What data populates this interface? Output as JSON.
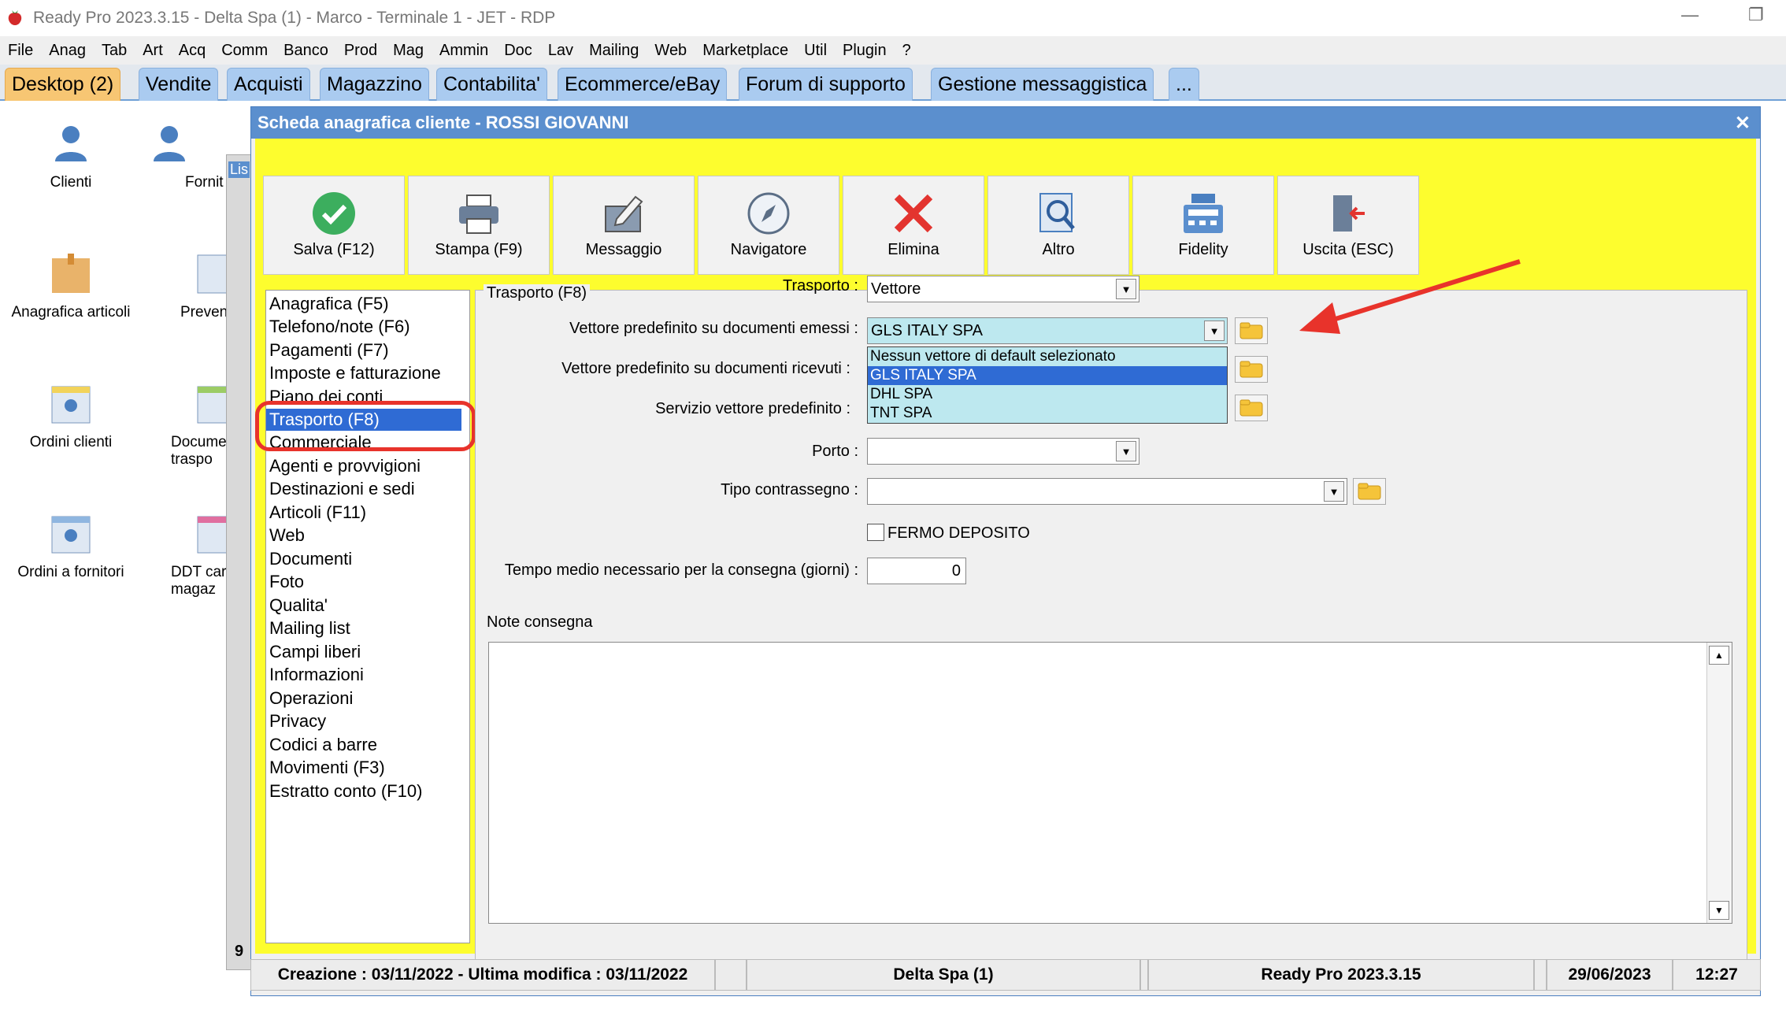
{
  "app": {
    "window_title": "Ready Pro 2023.3.15 - Delta Spa (1) - Marco - Terminale 1 - JET - RDP"
  },
  "menu": [
    "File",
    "Anag",
    "Tab",
    "Art",
    "Acq",
    "Comm",
    "Banco",
    "Prod",
    "Mag",
    "Ammin",
    "Doc",
    "Lav",
    "Mailing",
    "Web",
    "Marketplace",
    "Util",
    "Plugin",
    "?"
  ],
  "tabs": [
    "Desktop (2)",
    "Vendite",
    "Acquisti",
    "Magazzino",
    "Contabilita'",
    "Ecommerce/eBay",
    "Forum di supporto",
    "Gestione messaggistica",
    "..."
  ],
  "desktop_icons": [
    {
      "label": "Clienti"
    },
    {
      "label": "Fornit"
    },
    {
      "label": "Anagrafica articoli"
    },
    {
      "label": "Preven"
    },
    {
      "label": "Ordini clienti"
    },
    {
      "label": "Docume\ntraspo"
    },
    {
      "label": "Ordini a fornitori"
    },
    {
      "label": "DDT car\nmagaz"
    }
  ],
  "bg_window": {
    "tab_label": "Lis",
    "footer": "9"
  },
  "dialog": {
    "title": "Scheda anagrafica cliente - ROSSI GIOVANNI",
    "toolbar": [
      {
        "label": "Salva (F12)",
        "icon": "check-icon"
      },
      {
        "label": "Stampa (F9)",
        "icon": "printer-icon"
      },
      {
        "label": "Messaggio",
        "icon": "message-icon"
      },
      {
        "label": "Navigatore",
        "icon": "compass-icon"
      },
      {
        "label": "Elimina",
        "icon": "delete-icon"
      },
      {
        "label": "Altro",
        "icon": "search-icon"
      },
      {
        "label": "Fidelity",
        "icon": "register-icon"
      },
      {
        "label": "Uscita (ESC)",
        "icon": "exit-icon"
      }
    ],
    "nav": [
      "Anagrafica (F5)",
      "Telefono/note (F6)",
      "Pagamenti (F7)",
      "Imposte e fatturazione",
      "Piano dei conti",
      "Trasporto (F8)",
      "Commerciale",
      "Agenti e provvigioni",
      "Destinazioni e sedi",
      "Articoli (F11)",
      "Web",
      "Documenti",
      "Foto",
      "Qualita'",
      "Mailing list",
      "Campi liberi",
      "Informazioni",
      "Operazioni",
      "Privacy",
      "Codici a barre",
      "Movimenti (F3)",
      "Estratto conto (F10)"
    ],
    "nav_selected": "Trasporto (F8)",
    "panel": {
      "title": "Trasporto (F8)",
      "trasporto_label": "Trasporto :",
      "trasporto_value": "Vettore",
      "vettore_emessi_label": "Vettore predefinito su documenti emessi :",
      "vettore_emessi_value": "GLS ITALY SPA",
      "vettore_ricevuti_label": "Vettore predefinito su documenti ricevuti :",
      "servizio_label": "Servizio vettore predefinito :",
      "dropdown_options": [
        "Nessun vettore di default selezionato",
        "GLS ITALY SPA",
        "DHL SPA",
        "TNT SPA"
      ],
      "dropdown_highlighted": "GLS ITALY SPA",
      "porto_label": "Porto :",
      "porto_value": "",
      "contrassegno_label": "Tipo contrassegno :",
      "contrassegno_value": "",
      "fermo_label": "FERMO DEPOSITO",
      "fermo_checked": false,
      "tempo_label": "Tempo medio necessario per la consegna (giorni) :",
      "tempo_value": "0",
      "note_label": "Note consegna",
      "note_value": ""
    }
  },
  "status": {
    "creazione": "Creazione : 03/11/2022 - Ultima modifica : 03/11/2022",
    "company": "Delta Spa (1)",
    "version": "Ready Pro 2023.3.15",
    "date": "29/06/2023",
    "time": "12:27"
  },
  "colors": {
    "accent_blue": "#5b8fce",
    "highlight_yellow": "#fdfd2e",
    "selection_blue": "#2f6bd4",
    "annotation_red": "#e8332b",
    "dropdown_bg": "#bde8ef"
  }
}
